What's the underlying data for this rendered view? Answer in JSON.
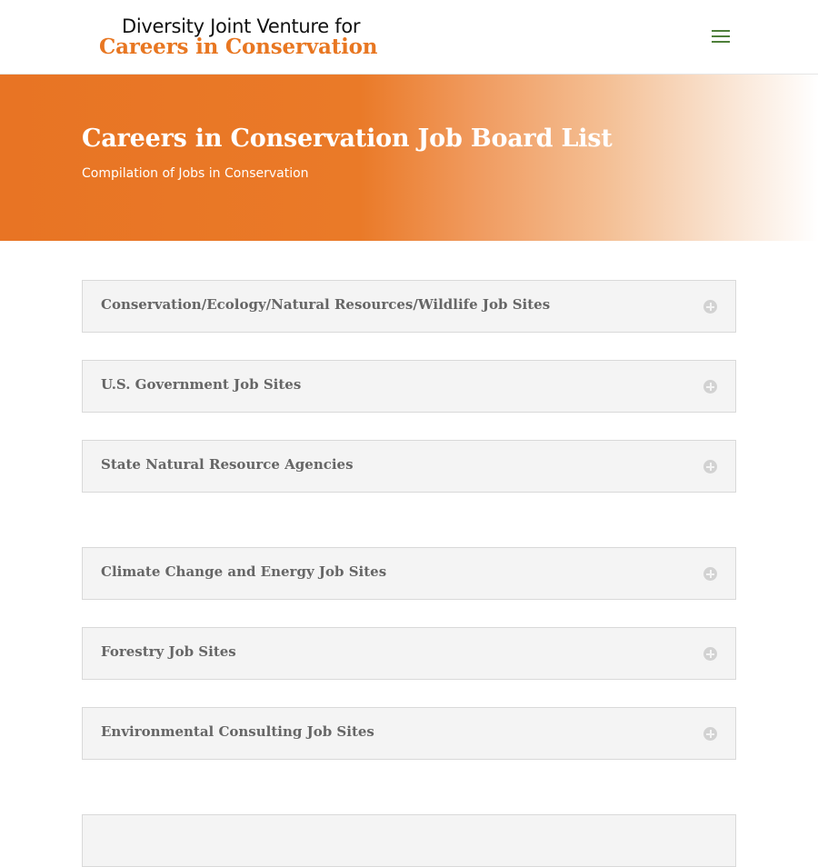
{
  "header": {
    "logo_line1": "Diversity Joint Venture for",
    "logo_line2": "Careers in Conservation",
    "menu_icon": "hamburger-menu-icon",
    "menu_color": "#4e7f3a"
  },
  "hero": {
    "title": "Careers in Conservation Job Board List",
    "subtitle": "Compilation of Jobs in Conservation",
    "accent_color": "#e87722"
  },
  "toggles": [
    {
      "title": "Conservation/Ecology/Natural Resources/Wildlife Job Sites",
      "icon": "plus-circle-icon",
      "expanded": false
    },
    {
      "title": "U.S. Government Job Sites",
      "icon": "plus-circle-icon",
      "expanded": false
    },
    {
      "title": "State Natural Resource Agencies",
      "icon": "plus-circle-icon",
      "expanded": false
    },
    {
      "title": "Climate Change and Energy Job Sites",
      "icon": "plus-circle-icon",
      "expanded": false
    },
    {
      "title": "Forestry Job Sites",
      "icon": "plus-circle-icon",
      "expanded": false
    },
    {
      "title": "Environmental Consulting Job Sites",
      "icon": "plus-circle-icon",
      "expanded": false
    },
    {
      "title": "",
      "icon": "plus-circle-icon",
      "expanded": false
    }
  ]
}
